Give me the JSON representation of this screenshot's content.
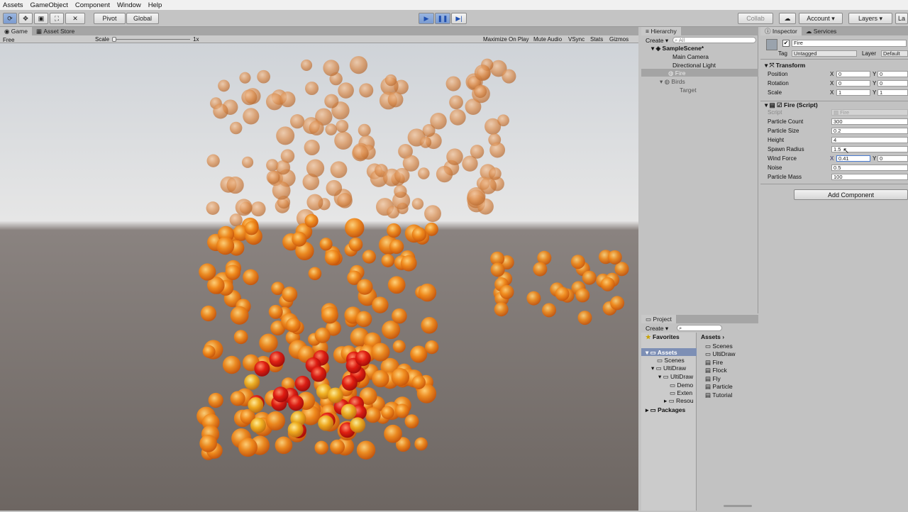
{
  "menu": [
    "Assets",
    "GameObject",
    "Component",
    "Window",
    "Help"
  ],
  "toolbar": {
    "pivot": "Pivot",
    "global": "Global",
    "collab": "Collab",
    "account": "Account",
    "layers": "Layers",
    "layout": "La"
  },
  "tabs": {
    "game": "Game",
    "asset_store": "Asset Store",
    "hierarchy": "Hierarchy",
    "inspector": "Inspector",
    "services": "Services",
    "project": "Project"
  },
  "gamebar": {
    "aspect": "Free Aspect",
    "scale_label": "Scale",
    "scale_value": "1x",
    "maximize": "Maximize On Play",
    "mute": "Mute Audio",
    "vsync": "VSync",
    "stats": "Stats",
    "gizmos": "Gizmos"
  },
  "hierarchy": {
    "create": "Create",
    "search_placeholder": "All",
    "scene": "SampleScene*",
    "items": [
      "Main Camera",
      "Directional Light",
      "Fire",
      "Birds",
      "Target"
    ]
  },
  "project": {
    "create": "Create",
    "favorites": "Favorites",
    "assets": "Assets",
    "tree": [
      "Scenes",
      "UltiDraw",
      "UltiDraw",
      "Demo",
      "Exten",
      "Resou"
    ],
    "packages": "Packages",
    "breadcrumb": "Assets",
    "files": [
      "Scenes",
      "UltiDraw",
      "Fire",
      "Flock",
      "Fly",
      "Particle",
      "Tutorial"
    ]
  },
  "inspector": {
    "object_name": "Fire",
    "tag_label": "Tag",
    "tag_value": "Untagged",
    "layer_label": "Layer",
    "layer_value": "Default",
    "transform_title": "Transform",
    "transform": [
      {
        "label": "Position",
        "x": "0",
        "y": "0"
      },
      {
        "label": "Rotation",
        "x": "0",
        "y": "0"
      },
      {
        "label": "Scale",
        "x": "1",
        "y": "1"
      }
    ],
    "script_title": "Fire (Script)",
    "script_label": "Script",
    "script_value": "Fire",
    "props": [
      {
        "label": "Particle Count",
        "value": "300"
      },
      {
        "label": "Particle Size",
        "value": "0.2"
      },
      {
        "label": "Height",
        "value": "4"
      },
      {
        "label": "Spawn Radius",
        "value": "1.5"
      },
      {
        "label": "Wind Force",
        "value": "0.41",
        "y": "0"
      },
      {
        "label": "Noise",
        "value": "0.5"
      },
      {
        "label": "Particle Mass",
        "value": "100"
      }
    ],
    "add_component": "Add Component"
  },
  "axis": {
    "x": "X",
    "y": "Y"
  }
}
